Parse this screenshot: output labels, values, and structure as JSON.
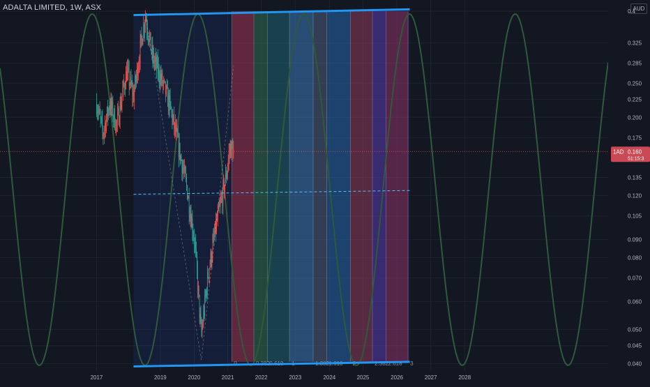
{
  "header": {
    "title": "ADALTA LIMITED, 1W, ASX",
    "currency": "AUD"
  },
  "price_label": {
    "ticker": "1AD",
    "value": "0.160",
    "countdown": "51:15:3"
  },
  "colors": {
    "background": "#131722",
    "up": "#ef5350",
    "down": "#26a69a",
    "channel": "#2196f3",
    "sine": "#2f5a3a"
  },
  "chart_data": {
    "type": "candlestick",
    "x_axis": {
      "ticks": [
        "2017",
        "2019",
        "2020",
        "2021",
        "2022",
        "2023",
        "2024",
        "2025",
        "2026",
        "2027",
        "2028"
      ],
      "range": [
        2015.5,
        2029.1
      ]
    },
    "y_axis": {
      "scale": "log",
      "range": [
        0.0385,
        0.415
      ],
      "ticks": [
        0.04,
        0.045,
        0.05,
        0.06,
        0.07,
        0.08,
        0.09,
        0.105,
        0.12,
        0.135,
        0.175,
        0.2,
        0.225,
        0.25,
        0.285,
        0.325,
        0.4
      ],
      "tick_labels": [
        "0.040",
        "0.045",
        "0.050",
        "0.060",
        "0.070",
        "0.080",
        "0.090",
        "0.105",
        "0.120",
        "0.135",
        "0.175",
        "0.200",
        "0.225",
        "0.250",
        "0.285",
        "0.325",
        "0.4"
      ]
    },
    "series": [
      {
        "type": "candlestick",
        "anchors": [
          [
            2017.16,
            0.22
          ],
          [
            2017.35,
            0.18
          ],
          [
            2017.55,
            0.22
          ],
          [
            2017.75,
            0.19
          ],
          [
            2018.05,
            0.27
          ],
          [
            2018.25,
            0.23
          ],
          [
            2018.5,
            0.34
          ],
          [
            2018.6,
            0.39
          ],
          [
            2018.8,
            0.3
          ],
          [
            2019.05,
            0.26
          ],
          [
            2019.3,
            0.22
          ],
          [
            2019.55,
            0.17
          ],
          [
            2019.8,
            0.13
          ],
          [
            2020.05,
            0.09
          ],
          [
            2020.25,
            0.048
          ],
          [
            2020.45,
            0.072
          ],
          [
            2020.7,
            0.1
          ],
          [
            2020.95,
            0.13
          ],
          [
            2021.1,
            0.165
          ],
          [
            2021.2,
            0.16
          ]
        ]
      }
    ],
    "last_price": 0.16,
    "overlays": {
      "channel_top": [
        [
          2018.25,
          0.39
        ],
        [
          2026.4,
          0.405
        ]
      ],
      "channel_bottom": [
        [
          2018.25,
          0.0393
        ],
        [
          2026.4,
          0.0405
        ]
      ],
      "midline": [
        [
          2018.25,
          0.121
        ],
        [
          2026.4,
          0.124
        ]
      ],
      "fib_levels": [
        {
          "x": 2021.15,
          "label": "0"
        },
        {
          "x": 2021.8,
          "label": "0.382"
        },
        {
          "x": 2022.2,
          "label": "0.618"
        },
        {
          "x": 2022.85,
          "label": "1"
        },
        {
          "x": 2023.55,
          "label": "1.382"
        },
        {
          "x": 2023.95,
          "label": "1.618"
        },
        {
          "x": 2024.65,
          "label": "2"
        },
        {
          "x": 2025.3,
          "label": "2.382"
        },
        {
          "x": 2025.7,
          "label": "2.618"
        },
        {
          "x": 2026.35,
          "label": "3"
        }
      ],
      "zone_colors": [
        "rgba(201,53,74,0.42)",
        "rgba(62,150,70,0.35)",
        "rgba(28,120,115,0.38)",
        "rgba(70,140,200,0.42)",
        "rgba(110,120,135,0.35)",
        "rgba(40,120,190,0.4)",
        "rgba(185,60,80,0.4)",
        "rgba(110,60,190,0.42)",
        "rgba(185,50,100,0.4)"
      ],
      "sine_cycle_years": 3.12,
      "sine_trough_year": 2020.15
    }
  }
}
